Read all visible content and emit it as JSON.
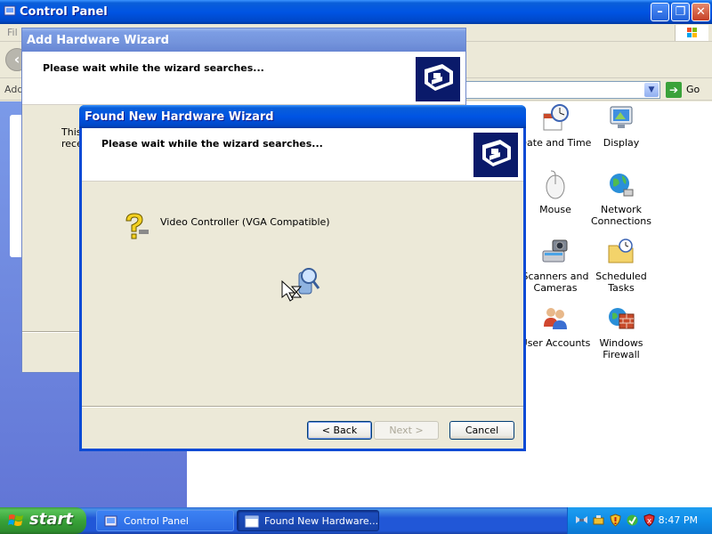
{
  "control_panel": {
    "title": "Control Panel",
    "menu": [
      "File"
    ],
    "menu_display": [
      "Fil"
    ],
    "address_label": "Add",
    "go_label": "Go",
    "icons": [
      {
        "name": "date-and-time",
        "label": "Date and Time"
      },
      {
        "name": "display",
        "label": "Display"
      },
      {
        "name": "mouse",
        "label": "Mouse"
      },
      {
        "name": "network-connections",
        "label": "Network Connections"
      },
      {
        "name": "scanners-and-cameras",
        "label": "Scanners and Cameras"
      },
      {
        "name": "scheduled-tasks",
        "label": "Scheduled Tasks"
      },
      {
        "name": "user-accounts",
        "label": "User Accounts"
      },
      {
        "name": "windows-firewall",
        "label": "Windows Firewall"
      }
    ]
  },
  "add_hardware_wizard": {
    "title": "Add Hardware Wizard",
    "heading": "Please wait while the wizard searches...",
    "body_text_1": "This",
    "body_text_2": "rece"
  },
  "found_new_hardware_wizard": {
    "title": "Found New Hardware Wizard",
    "heading": "Please wait while the wizard searches...",
    "device": "Video Controller (VGA Compatible)",
    "buttons": {
      "back": "< Back",
      "next": "Next >",
      "cancel": "Cancel"
    }
  },
  "taskbar": {
    "start_label": "start",
    "tasks": [
      {
        "label": "Control Panel",
        "active": false
      },
      {
        "label": "Found New Hardware...",
        "active": true
      }
    ],
    "clock": "8:47 PM"
  },
  "colors": {
    "title_active": "#0054e3",
    "title_inactive": "#7c9de4",
    "dialog_face": "#ece9d8",
    "sidebar": "#6f87dd",
    "taskbar": "#2157d7",
    "start_green": "#38a238"
  }
}
